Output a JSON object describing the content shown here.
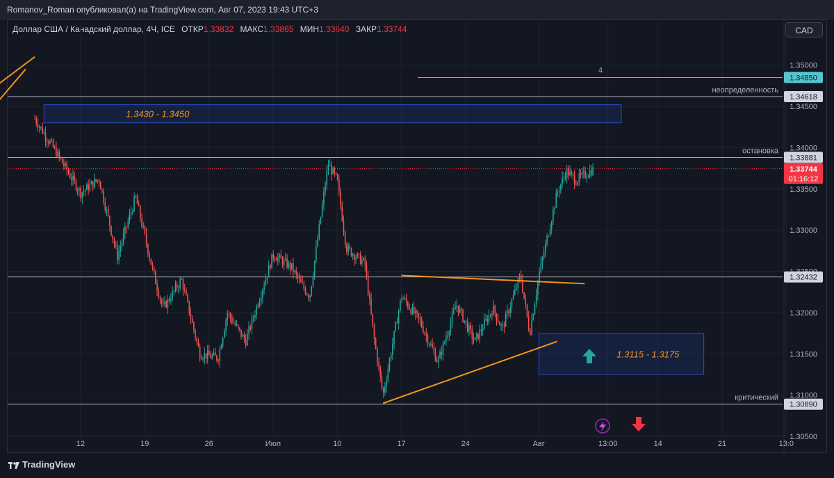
{
  "header": {
    "publish_line": "Romanov_Roman опубликовал(а) на TradingView.com, Авг 07, 2023 19:43 UTC+3"
  },
  "legend": {
    "symbol": "Доллар США / Канадский доллар, 4Ч, ICE",
    "open_label": "ОТКР",
    "open": "1.33832",
    "high_label": "МАКС",
    "high": "1.33865",
    "low_label": "МИН",
    "low": "1.33640",
    "close_label": "ЗАКР",
    "close": "1.33744"
  },
  "currency_button": "CAD",
  "brand": "TradingView",
  "chart_data": {
    "type": "candlestick",
    "symbol": "USD/CAD",
    "timeframe": "4Ч",
    "y_range": [
      1.305,
      1.353
    ],
    "y_ticks": [
      "1.35000",
      "1.34500",
      "1.34000",
      "1.33500",
      "1.33000",
      "1.32500",
      "1.32000",
      "1.31500",
      "1.31000",
      "1.30500"
    ],
    "x_ticks": [
      "12",
      "19",
      "26",
      "Июл",
      "10",
      "17",
      "24",
      "Авг",
      "13:00",
      "14",
      "21",
      "13:0"
    ],
    "x_tick_dates": [
      "2023-06-12",
      "2023-06-19",
      "2023-06-26",
      "2023-07-03",
      "2023-07-10",
      "2023-07-17",
      "2023-07-24",
      "2023-08-01",
      "2023-08-08 13:00",
      "2023-08-14",
      "2023-08-21",
      "2023-08-28"
    ],
    "path_anchors": [
      [
        "2023-06-07",
        1.3435
      ],
      [
        "2023-06-09",
        1.34
      ],
      [
        "2023-06-12",
        1.3345
      ],
      [
        "2023-06-14",
        1.3362
      ],
      [
        "2023-06-16",
        1.3268
      ],
      [
        "2023-06-18",
        1.334
      ],
      [
        "2023-06-20",
        1.3245
      ],
      [
        "2023-06-21",
        1.3205
      ],
      [
        "2023-06-23",
        1.324
      ],
      [
        "2023-06-25",
        1.315
      ],
      [
        "2023-06-27",
        1.3145
      ],
      [
        "2023-06-28",
        1.32
      ],
      [
        "2023-06-30",
        1.3165
      ],
      [
        "2023-07-03",
        1.327
      ],
      [
        "2023-07-05",
        1.3255
      ],
      [
        "2023-07-06",
        1.3235
      ],
      [
        "2023-07-07",
        1.322
      ],
      [
        "2023-07-09",
        1.338
      ],
      [
        "2023-07-10",
        1.336
      ],
      [
        "2023-07-11",
        1.3278
      ],
      [
        "2023-07-13",
        1.326
      ],
      [
        "2023-07-14",
        1.317
      ],
      [
        "2023-07-15",
        1.31
      ],
      [
        "2023-07-16",
        1.316
      ],
      [
        "2023-07-17",
        1.322
      ],
      [
        "2023-07-19",
        1.319
      ],
      [
        "2023-07-21",
        1.314
      ],
      [
        "2023-07-23",
        1.321
      ],
      [
        "2023-07-25",
        1.3165
      ],
      [
        "2023-07-27",
        1.3205
      ],
      [
        "2023-07-28",
        1.318
      ],
      [
        "2023-07-30",
        1.3245
      ],
      [
        "2023-07-31",
        1.3175
      ],
      [
        "2023-08-01",
        1.3245
      ],
      [
        "2023-08-03",
        1.3345
      ],
      [
        "2023-08-04",
        1.3372
      ],
      [
        "2023-08-05",
        1.336
      ],
      [
        "2023-08-07",
        1.3374
      ]
    ],
    "horizontal_levels": [
      {
        "price": 1.3485,
        "label": "1.34850",
        "note": "4",
        "color": "#56c5d0"
      },
      {
        "price": 1.34618,
        "label": "1.34618",
        "note": "неопределенность",
        "color": "#b2b5be"
      },
      {
        "price": 1.33881,
        "label": "1.33881",
        "note": "остановка",
        "color": "#b2b5be"
      },
      {
        "price": 1.32432,
        "label": "1.32432",
        "note": "",
        "color": "#b2b5be"
      },
      {
        "price": 1.3089,
        "label": "1.30890",
        "note": "критический",
        "color": "#b2b5be"
      }
    ],
    "current_price": {
      "price": 1.33744,
      "label": "1.33744",
      "countdown": "01:16:12",
      "color": "#f23645"
    },
    "zones": [
      {
        "label": "1.3430 - 1.3450",
        "from": "2023-06-08",
        "to": "2023-08-10",
        "top": 1.3452,
        "bottom": 1.343
      },
      {
        "label": "1.3115 - 1.3175",
        "from": "2023-08-01",
        "to": "2023-08-19",
        "top": 1.3175,
        "bottom": 1.3125
      }
    ],
    "trend_lines": [
      {
        "from": [
          "2023-06-01",
          1.343
        ],
        "to": [
          "2023-06-06",
          1.3495
        ]
      },
      {
        "from": [
          "2023-06-01",
          1.346
        ],
        "to": [
          "2023-06-07",
          1.351
        ]
      },
      {
        "from": [
          "2023-07-15",
          1.309
        ],
        "to": [
          "2023-08-03",
          1.3165
        ]
      },
      {
        "from": [
          "2023-07-17",
          1.3245
        ],
        "to": [
          "2023-08-06",
          1.3235
        ]
      }
    ],
    "colors": {
      "up": "#26a69a",
      "down": "#ef5350",
      "zone": "#2962ff",
      "trend": "#f7931a",
      "background": "#131722"
    },
    "grid": true
  }
}
